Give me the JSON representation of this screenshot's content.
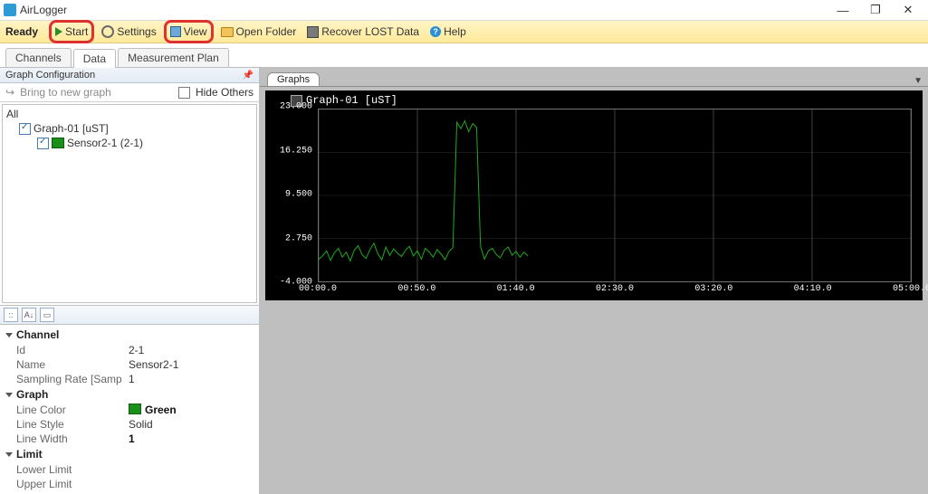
{
  "app": {
    "title": "AirLogger"
  },
  "window_controls": {
    "minimize": "—",
    "maximize": "❐",
    "close": "✕"
  },
  "toolbar": {
    "ready": "Ready",
    "start": "Start",
    "settings": "Settings",
    "view": "View",
    "open_folder": "Open Folder",
    "recover": "Recover LOST Data",
    "help": "Help",
    "help_glyph": "?"
  },
  "tabs": {
    "channels": "Channels",
    "data": "Data",
    "plan": "Measurement Plan",
    "active": "Data"
  },
  "left": {
    "panel_title": "Graph Configuration",
    "bring": "Bring to new graph",
    "hide_others": "Hide Others",
    "tree": {
      "all": "All",
      "graph01": "Graph-01 [uST]",
      "sensor": "Sensor2-1 (2-1)"
    },
    "propbar": {
      "cat_icon": "::",
      "az_icon": "A↓",
      "misc_icon": "▭"
    },
    "groups": {
      "channel": {
        "label": "Channel",
        "id_k": "Id",
        "id_v": "2-1",
        "name_k": "Name",
        "name_v": "Sensor2-1",
        "sr_k": "Sampling Rate [Samp",
        "sr_v": "1"
      },
      "graph": {
        "label": "Graph",
        "color_k": "Line Color",
        "color_v": "Green",
        "style_k": "Line Style",
        "style_v": "Solid",
        "width_k": "Line Width",
        "width_v": "1"
      },
      "limit": {
        "label": "Limit",
        "lower_k": "Lower Limit",
        "lower_v": "",
        "upper_k": "Upper Limit",
        "upper_v": ""
      }
    }
  },
  "right": {
    "tab": "Graphs",
    "title": "Graph-01 [uST]",
    "yticks": [
      "23.000",
      "16.250",
      "9.500",
      "2.750",
      "-4.000"
    ],
    "xticks": [
      "00:00.0",
      "00:50.0",
      "01:40.0",
      "02:30.0",
      "03:20.0",
      "04:10.0",
      "05:00.0"
    ]
  },
  "chart_data": {
    "type": "line",
    "title": "Graph-01 [uST]",
    "xlabel": "",
    "ylabel": "",
    "ylim": [
      -4.0,
      23.0
    ],
    "xunit": "seconds",
    "xlim": [
      0,
      300
    ],
    "series": [
      {
        "name": "Sensor2-1 (2-1)",
        "color": "#1faa1f",
        "x": [
          0,
          2,
          4,
          6,
          8,
          10,
          12,
          14,
          16,
          18,
          20,
          22,
          24,
          26,
          28,
          30,
          32,
          34,
          36,
          38,
          40,
          42,
          44,
          46,
          48,
          50,
          52,
          54,
          56,
          58,
          60,
          62,
          64,
          66,
          68,
          70,
          72,
          74,
          76,
          78,
          80,
          82,
          84,
          86,
          88,
          90,
          92,
          94,
          96,
          98,
          100,
          102,
          104,
          106
        ],
        "values": [
          -0.5,
          0.0,
          0.8,
          -0.7,
          0.5,
          1.2,
          -0.2,
          0.6,
          -0.8,
          0.9,
          1.6,
          0.2,
          -0.4,
          1.0,
          2.0,
          0.3,
          -0.6,
          1.4,
          0.1,
          1.1,
          0.4,
          -0.1,
          0.9,
          1.5,
          0.0,
          0.8,
          -0.5,
          1.2,
          0.6,
          -0.2,
          1.0,
          0.3,
          -0.6,
          0.7,
          1.3,
          21.0,
          20.0,
          21.2,
          19.5,
          20.8,
          20.2,
          1.5,
          -0.5,
          0.8,
          1.2,
          0.2,
          -0.3,
          0.9,
          1.4,
          0.1,
          0.7,
          -0.2,
          0.6,
          0.0
        ]
      }
    ]
  }
}
